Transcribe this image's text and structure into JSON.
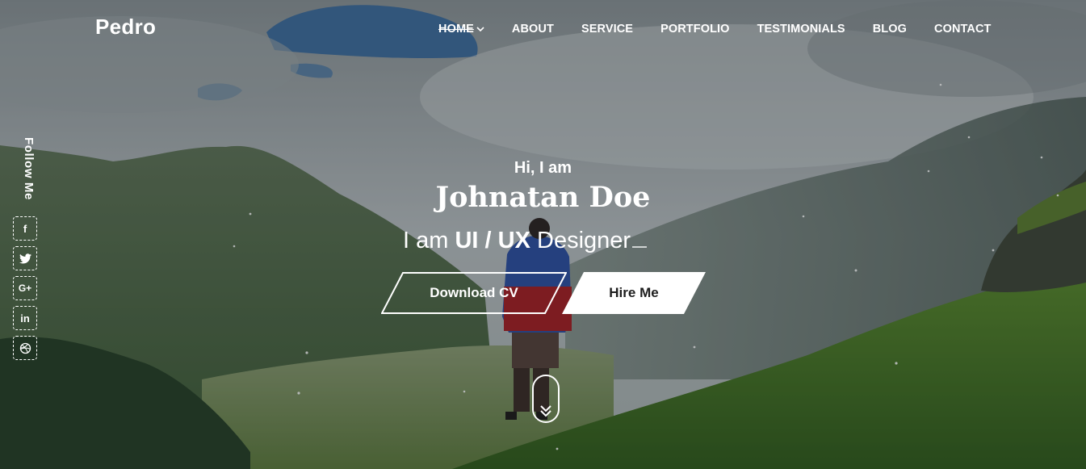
{
  "brand": {
    "logo": "Pedro"
  },
  "nav": {
    "items": [
      {
        "label": "HOME",
        "active": true
      },
      {
        "label": "ABOUT"
      },
      {
        "label": "SERVICE"
      },
      {
        "label": "PORTFOLIO"
      },
      {
        "label": "TESTIMONIALS"
      },
      {
        "label": "BLOG"
      },
      {
        "label": "CONTACT"
      }
    ]
  },
  "sidebar": {
    "follow_label": "Follow Me",
    "social": [
      {
        "icon": "facebook-icon",
        "glyph": "f"
      },
      {
        "icon": "twitter-icon"
      },
      {
        "icon": "google-plus-icon",
        "glyph": "G+"
      },
      {
        "icon": "linkedin-icon",
        "glyph": "in"
      },
      {
        "icon": "dribbble-icon"
      }
    ]
  },
  "hero": {
    "greeting": "Hi, I am",
    "name": "Johnatan Doe",
    "role_prefix": "I am ",
    "role_bold": "UI / UX",
    "role_suffix": " Designer",
    "download_label": "Download CV",
    "hire_label": "Hire Me"
  },
  "colors": {
    "text": "#ffffff",
    "hire_button_bg": "#ffffff",
    "hire_button_text": "#1d1d1d"
  }
}
